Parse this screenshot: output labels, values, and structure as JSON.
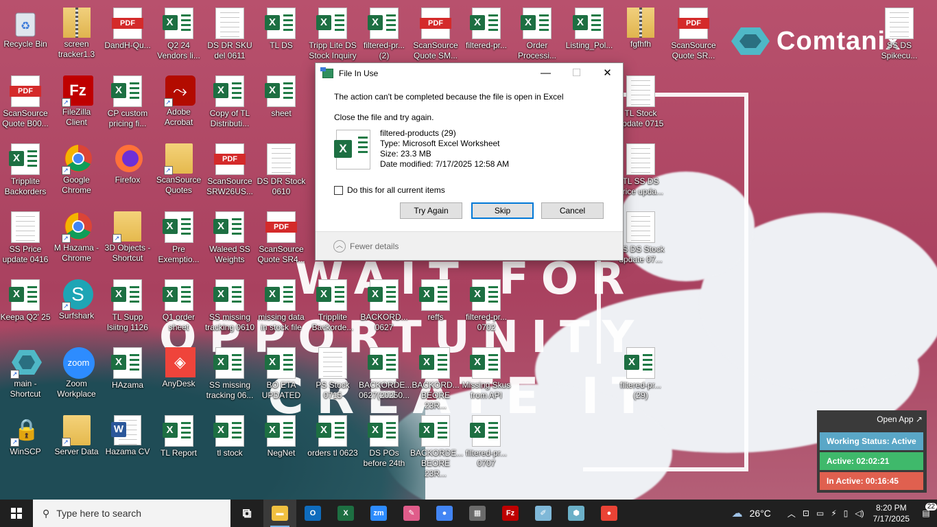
{
  "desktop_icons": [
    {
      "label": "Recycle Bin",
      "type": "recycle"
    },
    {
      "label": "screen tracker1.3",
      "type": "zip"
    },
    {
      "label": "DandH-Qu...",
      "type": "pdf"
    },
    {
      "label": "Q2 24 Vendors li...",
      "type": "xl"
    },
    {
      "label": "DS DR SKU del 0611",
      "type": "doc"
    },
    {
      "label": "TL DS",
      "type": "xl"
    },
    {
      "label": "Tripp Lite DS Stock Inquiry",
      "type": "xl"
    },
    {
      "label": "filtered-pr... (2)",
      "type": "xl"
    },
    {
      "label": "ScanSource Quote SM...",
      "type": "pdf"
    },
    {
      "label": "filtered-pr...",
      "type": "xl"
    },
    {
      "label": "Order Processi...",
      "type": "xl"
    },
    {
      "label": "Listing_Pol...",
      "type": "xl"
    },
    {
      "label": "fgfhfh",
      "type": "zip"
    },
    {
      "label": "ScanSource Quote SR...",
      "type": "pdf"
    },
    {
      "label": "SS DS Spikecu...",
      "type": "doc"
    },
    {
      "label": "ScanSource Quote B00...",
      "type": "pdf"
    },
    {
      "label": "FileZilla Client",
      "type": "filezilla"
    },
    {
      "label": "CP custom pricing fi...",
      "type": "xl"
    },
    {
      "label": "Adobe Acrobat",
      "type": "acrobat"
    },
    {
      "label": "Copy of TL Distributi...",
      "type": "xl"
    },
    {
      "label": "sheet",
      "type": "xl"
    },
    {
      "label": "TL Stock update 0715",
      "type": "doc"
    },
    {
      "label": "Tripplite Backorders",
      "type": "xl"
    },
    {
      "label": "Google Chrome",
      "type": "chrome"
    },
    {
      "label": "Firefox",
      "type": "firefox"
    },
    {
      "label": "ScanSource Quotes",
      "type": "folder"
    },
    {
      "label": "ScanSource SRW26US...",
      "type": "pdf"
    },
    {
      "label": "DS DR Stock 0610",
      "type": "doc"
    },
    {
      "label": "TL SS DS price upda...",
      "type": "doc"
    },
    {
      "label": "SS Price update 0416",
      "type": "doc"
    },
    {
      "label": "M Hazama - Chrome",
      "type": "chrome"
    },
    {
      "label": "3D Objects - Shortcut",
      "type": "folder"
    },
    {
      "label": "Pre Exemptio...",
      "type": "xl"
    },
    {
      "label": "Waleed SS Weights",
      "type": "xl"
    },
    {
      "label": "ScanSource Quote SR4...",
      "type": "pdf"
    },
    {
      "label": "SS DS Stock update 07...",
      "type": "doc"
    },
    {
      "label": "Keepa Q2' 25",
      "type": "xl"
    },
    {
      "label": "Surfshark",
      "type": "surfshark"
    },
    {
      "label": "TL Supp lsiitng 1126",
      "type": "xl"
    },
    {
      "label": "Q1 order sheet",
      "type": "xl"
    },
    {
      "label": "SS missing tracking 0610",
      "type": "xl"
    },
    {
      "label": "missing data in stock file",
      "type": "xl"
    },
    {
      "label": "Tripplite Backorde...",
      "type": "xl"
    },
    {
      "label": "BACKORD... 0627",
      "type": "xl"
    },
    {
      "label": "reffs",
      "type": "xl"
    },
    {
      "label": "filtered-pr... 0702",
      "type": "xl"
    },
    {
      "label": "main - Shortcut",
      "type": "hex"
    },
    {
      "label": "Zoom Workplace",
      "type": "zoom"
    },
    {
      "label": "HAzama",
      "type": "xl"
    },
    {
      "label": "AnyDesk",
      "type": "anydesk"
    },
    {
      "label": "SS missing tracking 06...",
      "type": "xl"
    },
    {
      "label": "BO ETA UPDATED",
      "type": "xl"
    },
    {
      "label": "PS Stock 0715",
      "type": "doc"
    },
    {
      "label": "BACKORDE... 0627(20250...",
      "type": "xl"
    },
    {
      "label": "BACKORD... BEORE 23R...",
      "type": "xl"
    },
    {
      "label": "Missing Skus from API",
      "type": "xl"
    },
    {
      "label": "filtered-pr... (29)",
      "type": "xl"
    },
    {
      "label": "WinSCP",
      "type": "winscp"
    },
    {
      "label": "Server Data",
      "type": "folder"
    },
    {
      "label": "Hazama CV",
      "type": "word"
    },
    {
      "label": "TL Report",
      "type": "xl"
    },
    {
      "label": "tl stock",
      "type": "xl"
    },
    {
      "label": "NegNet",
      "type": "xl"
    },
    {
      "label": "orders tl 0623",
      "type": "xl"
    },
    {
      "label": "DS POs before 24th",
      "type": "xl"
    },
    {
      "label": "BACKORDE... BEORE 23R...",
      "type": "xl"
    },
    {
      "label": "filtered-pr... 0707",
      "type": "xl"
    }
  ],
  "wallpaper": {
    "brand": "Comtanix",
    "words": [
      "WAIT FOR",
      "OPPORTUNITY",
      "CREATE IT"
    ]
  },
  "dialog": {
    "title": "File In Use",
    "message": "The action can't be completed because the file is open in Excel",
    "sub_message": "Close the file and try again.",
    "file": {
      "name": "filtered-products (29)",
      "type": "Type: Microsoft Excel Worksheet",
      "size": "Size: 23.3 MB",
      "modified": "Date modified: 7/17/2025 12:58 AM"
    },
    "checkbox_label": "Do this for all current items",
    "checkbox_checked": false,
    "buttons": {
      "try_again": "Try Again",
      "skip": "Skip",
      "cancel": "Cancel"
    },
    "fewer_details": "Fewer details",
    "window_controls": {
      "minimize": "—",
      "maximize": "☐",
      "close": "✕"
    }
  },
  "status_widget": {
    "open_app": "Open App ↗",
    "working_status": "Working Status: Active",
    "active": "Active: 02:02:21",
    "inactive": "In Active: 00:16:45",
    "colors": {
      "working": "#5aa7c7",
      "active": "#3fb96b",
      "inactive": "#e0604f"
    }
  },
  "taskbar": {
    "search_placeholder": "Type here to search",
    "apps": [
      {
        "name": "task-view",
        "glyph": "⧉",
        "color": "#202020"
      },
      {
        "name": "file-explorer",
        "glyph": "▬",
        "color": "#f0c040"
      },
      {
        "name": "outlook",
        "glyph": "O",
        "color": "#0f6cbd"
      },
      {
        "name": "excel",
        "glyph": "X",
        "color": "#1d6f42"
      },
      {
        "name": "zoom",
        "glyph": "zm",
        "color": "#2d8cff"
      },
      {
        "name": "paint",
        "glyph": "✎",
        "color": "#e05c8a"
      },
      {
        "name": "chrome-profile",
        "glyph": "●",
        "color": "#4285f4"
      },
      {
        "name": "calculator",
        "glyph": "▦",
        "color": "#6a6a6a"
      },
      {
        "name": "filezilla",
        "glyph": "Fz",
        "color": "#bf0000"
      },
      {
        "name": "notepad",
        "glyph": "✐",
        "color": "#7fb8d8"
      },
      {
        "name": "app-hex",
        "glyph": "⬢",
        "color": "#6bb0c8"
      },
      {
        "name": "chrome",
        "glyph": "●",
        "color": "#ea4335"
      }
    ],
    "weather": "26°C",
    "time": "8:20 PM",
    "date": "7/17/2025",
    "notifications": "22"
  }
}
